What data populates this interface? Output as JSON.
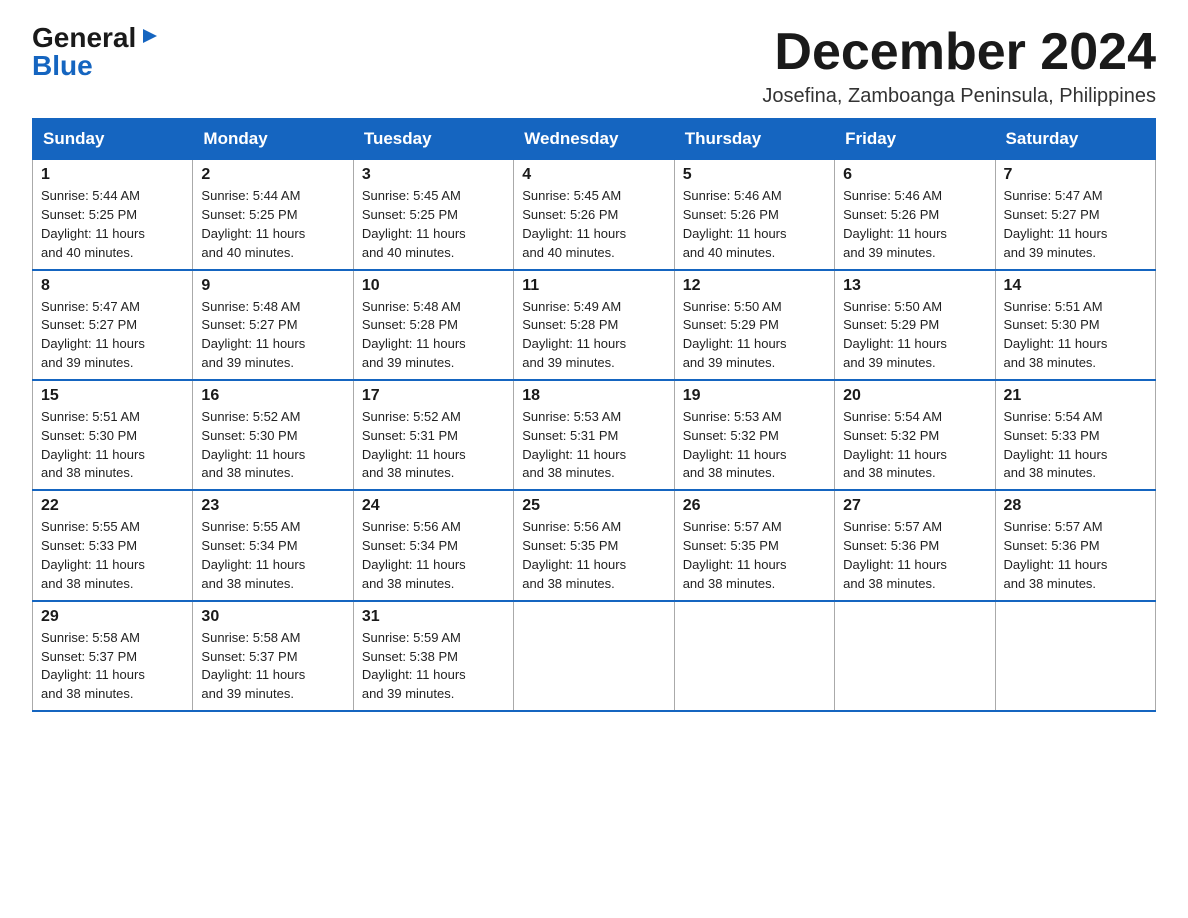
{
  "logo": {
    "general": "General",
    "triangle": "▶",
    "blue": "Blue"
  },
  "title": "December 2024",
  "subtitle": "Josefina, Zamboanga Peninsula, Philippines",
  "days_of_week": [
    "Sunday",
    "Monday",
    "Tuesday",
    "Wednesday",
    "Thursday",
    "Friday",
    "Saturday"
  ],
  "weeks": [
    [
      {
        "num": "1",
        "sunrise": "5:44 AM",
        "sunset": "5:25 PM",
        "daylight": "11 hours and 40 minutes."
      },
      {
        "num": "2",
        "sunrise": "5:44 AM",
        "sunset": "5:25 PM",
        "daylight": "11 hours and 40 minutes."
      },
      {
        "num": "3",
        "sunrise": "5:45 AM",
        "sunset": "5:25 PM",
        "daylight": "11 hours and 40 minutes."
      },
      {
        "num": "4",
        "sunrise": "5:45 AM",
        "sunset": "5:26 PM",
        "daylight": "11 hours and 40 minutes."
      },
      {
        "num": "5",
        "sunrise": "5:46 AM",
        "sunset": "5:26 PM",
        "daylight": "11 hours and 40 minutes."
      },
      {
        "num": "6",
        "sunrise": "5:46 AM",
        "sunset": "5:26 PM",
        "daylight": "11 hours and 39 minutes."
      },
      {
        "num": "7",
        "sunrise": "5:47 AM",
        "sunset": "5:27 PM",
        "daylight": "11 hours and 39 minutes."
      }
    ],
    [
      {
        "num": "8",
        "sunrise": "5:47 AM",
        "sunset": "5:27 PM",
        "daylight": "11 hours and 39 minutes."
      },
      {
        "num": "9",
        "sunrise": "5:48 AM",
        "sunset": "5:27 PM",
        "daylight": "11 hours and 39 minutes."
      },
      {
        "num": "10",
        "sunrise": "5:48 AM",
        "sunset": "5:28 PM",
        "daylight": "11 hours and 39 minutes."
      },
      {
        "num": "11",
        "sunrise": "5:49 AM",
        "sunset": "5:28 PM",
        "daylight": "11 hours and 39 minutes."
      },
      {
        "num": "12",
        "sunrise": "5:50 AM",
        "sunset": "5:29 PM",
        "daylight": "11 hours and 39 minutes."
      },
      {
        "num": "13",
        "sunrise": "5:50 AM",
        "sunset": "5:29 PM",
        "daylight": "11 hours and 39 minutes."
      },
      {
        "num": "14",
        "sunrise": "5:51 AM",
        "sunset": "5:30 PM",
        "daylight": "11 hours and 38 minutes."
      }
    ],
    [
      {
        "num": "15",
        "sunrise": "5:51 AM",
        "sunset": "5:30 PM",
        "daylight": "11 hours and 38 minutes."
      },
      {
        "num": "16",
        "sunrise": "5:52 AM",
        "sunset": "5:30 PM",
        "daylight": "11 hours and 38 minutes."
      },
      {
        "num": "17",
        "sunrise": "5:52 AM",
        "sunset": "5:31 PM",
        "daylight": "11 hours and 38 minutes."
      },
      {
        "num": "18",
        "sunrise": "5:53 AM",
        "sunset": "5:31 PM",
        "daylight": "11 hours and 38 minutes."
      },
      {
        "num": "19",
        "sunrise": "5:53 AM",
        "sunset": "5:32 PM",
        "daylight": "11 hours and 38 minutes."
      },
      {
        "num": "20",
        "sunrise": "5:54 AM",
        "sunset": "5:32 PM",
        "daylight": "11 hours and 38 minutes."
      },
      {
        "num": "21",
        "sunrise": "5:54 AM",
        "sunset": "5:33 PM",
        "daylight": "11 hours and 38 minutes."
      }
    ],
    [
      {
        "num": "22",
        "sunrise": "5:55 AM",
        "sunset": "5:33 PM",
        "daylight": "11 hours and 38 minutes."
      },
      {
        "num": "23",
        "sunrise": "5:55 AM",
        "sunset": "5:34 PM",
        "daylight": "11 hours and 38 minutes."
      },
      {
        "num": "24",
        "sunrise": "5:56 AM",
        "sunset": "5:34 PM",
        "daylight": "11 hours and 38 minutes."
      },
      {
        "num": "25",
        "sunrise": "5:56 AM",
        "sunset": "5:35 PM",
        "daylight": "11 hours and 38 minutes."
      },
      {
        "num": "26",
        "sunrise": "5:57 AM",
        "sunset": "5:35 PM",
        "daylight": "11 hours and 38 minutes."
      },
      {
        "num": "27",
        "sunrise": "5:57 AM",
        "sunset": "5:36 PM",
        "daylight": "11 hours and 38 minutes."
      },
      {
        "num": "28",
        "sunrise": "5:57 AM",
        "sunset": "5:36 PM",
        "daylight": "11 hours and 38 minutes."
      }
    ],
    [
      {
        "num": "29",
        "sunrise": "5:58 AM",
        "sunset": "5:37 PM",
        "daylight": "11 hours and 38 minutes."
      },
      {
        "num": "30",
        "sunrise": "5:58 AM",
        "sunset": "5:37 PM",
        "daylight": "11 hours and 39 minutes."
      },
      {
        "num": "31",
        "sunrise": "5:59 AM",
        "sunset": "5:38 PM",
        "daylight": "11 hours and 39 minutes."
      },
      null,
      null,
      null,
      null
    ]
  ],
  "labels": {
    "sunrise": "Sunrise:",
    "sunset": "Sunset:",
    "daylight": "Daylight:"
  }
}
